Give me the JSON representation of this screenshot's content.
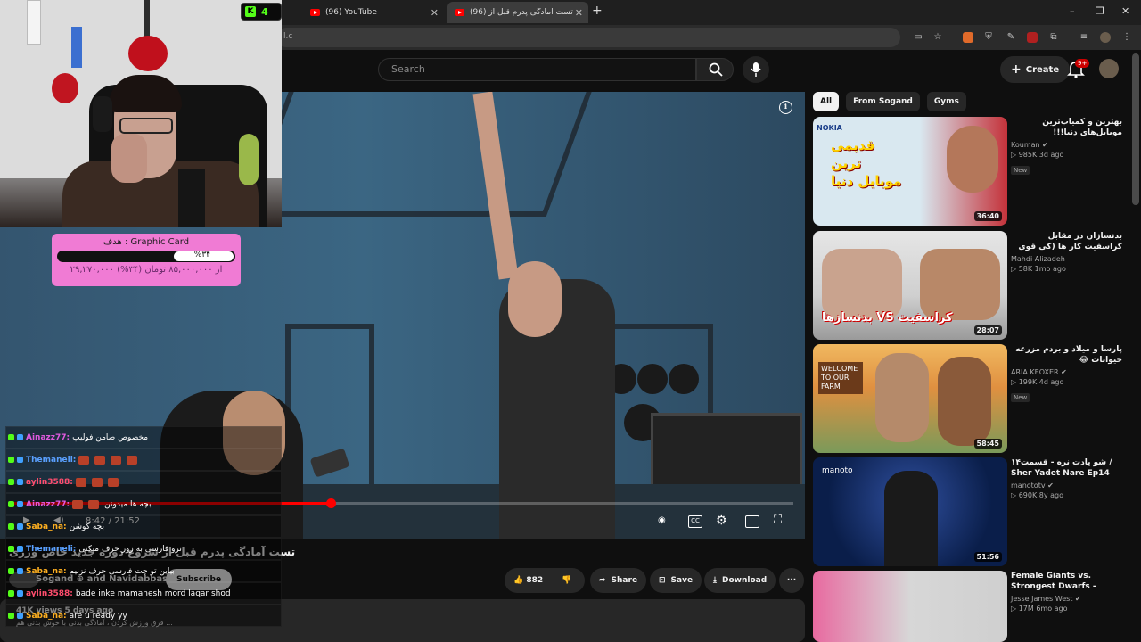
{
  "browser": {
    "tabs": [
      {
        "title": "(96) YouTube",
        "active": false
      },
      {
        "title": "تست آمادگی پدرم قبل از (96)",
        "active": true
      }
    ],
    "new_tab": "+",
    "address_fragment": "l.c",
    "window_controls": [
      "–",
      "❐",
      "✕"
    ]
  },
  "kick_viewers": {
    "icon": "K",
    "count": "4"
  },
  "youtube": {
    "search_placeholder": "Search",
    "create_label": "Create",
    "notif_badge": "9+",
    "video": {
      "time": "8:42 / 21:52",
      "progress_fraction": 0.41,
      "title": "تست آمادگی پدرم قبل از شروع دوره جدید خاص ورزی",
      "channel": "Sogand ⊕ and Navidabbasi",
      "subscribe": "Subscribe",
      "views": "41K views  5 days ago",
      "desc": "فرق ورزش کردن ، آمادگی بدنی با خوش بدنی هم ..."
    },
    "actions": {
      "likes": "882",
      "share": "Share",
      "save": "Save",
      "download": "Download",
      "more": "···"
    },
    "chips": [
      "All",
      "From Sogand",
      "Gyms"
    ],
    "recommended": [
      {
        "title": "بهترین و کمیاب‌ترین موبایل‌های دنیا!!!",
        "channel": "Kouman",
        "meta": "▷ 985K  3d ago",
        "new": "New",
        "duration": "36:40",
        "thumb_text": "قدیمی ترین موبایل دنیا",
        "thumb_brand": "NOKIA",
        "colors": [
          "#d9e8f0",
          "#c4323a"
        ]
      },
      {
        "title": "بدنسازان در مقابل کراسفیت کار ها (کی قوی تره؟)",
        "channel": "Mahdi Alizadeh",
        "meta": "▷ 58K  1mo ago",
        "new": "",
        "duration": "28:07",
        "thumb_text": "بدنسازها VS کراسفیت",
        "thumb_brand": "",
        "colors": [
          "#d7d7d7",
          "#c0392b"
        ]
      },
      {
        "title": "پارسا و میلاد و بردم مزرعه حیوانات 😂",
        "channel": "ARIA KEOXER",
        "meta": "▷ 199K  4d ago",
        "new": "New",
        "duration": "58:45",
        "thumb_text": "WELCOME TO OUR FARM",
        "thumb_brand": "",
        "colors": [
          "#e0a050",
          "#7a9a5a"
        ]
      },
      {
        "title": "شو یادت نره - قسمت۱۴ / Sher Yadet Nare Ep14",
        "channel": "manototv",
        "meta": "▷ 690K  8y ago",
        "new": "",
        "duration": "51:56",
        "thumb_text": "",
        "thumb_brand": "manoto",
        "colors": [
          "#0a1e4a",
          "#3050a0"
        ]
      },
      {
        "title": "Female Giants vs. Strongest Dwarfs - (Who's Stronger?)",
        "channel": "Jesse James West",
        "meta": "▷ 17M  6mo ago",
        "new": "",
        "duration": "",
        "thumb_text": "",
        "thumb_brand": "",
        "colors": [
          "#d7d7d7",
          "#e86aa0"
        ]
      }
    ]
  },
  "stream_overlay": {
    "goal": {
      "title": "هدف : Graphic Card",
      "percent_label": "%۳۴",
      "progress_fraction": 0.34,
      "amount": "۲۹,۲۷۰,۰۰۰ از ۸۵,۰۰۰,۰۰۰ تومان (۳۴%)"
    },
    "chat": [
      {
        "user": "Ainazz77",
        "user_color": "#e05adf",
        "text": "مخصوص صامن فولیپ",
        "emotes": 0
      },
      {
        "user": "Themaneli",
        "user_color": "#5aa0ff",
        "text": "",
        "emotes": 4
      },
      {
        "user": "aylin3588",
        "user_color": "#ff4d6d",
        "text": "",
        "emotes": 3
      },
      {
        "user": "Ainazz77",
        "user_color": "#e05adf",
        "text": "بچه ها میدونن",
        "emotes": 2
      },
      {
        "user": "Saba_na",
        "user_color": "#ffb020",
        "text": "بچه گوشن",
        "emotes": 0
      },
      {
        "user": "Themaneli",
        "user_color": "#5aa0ff",
        "text": "نرو فارسی به زور حرف میکنی",
        "emotes": 0
      },
      {
        "user": "Saba_na",
        "user_color": "#ffb020",
        "text": "بیاین تو چت فارسی حرف نزنیم",
        "emotes": 0
      },
      {
        "user": "aylin3588",
        "user_color": "#ff4d6d",
        "text": "bade inke mamanesh mord laqar shod",
        "emotes": 0
      },
      {
        "user": "Saba_na",
        "user_color": "#ffb020",
        "text": "are u ready yy",
        "emotes": 0
      }
    ]
  }
}
